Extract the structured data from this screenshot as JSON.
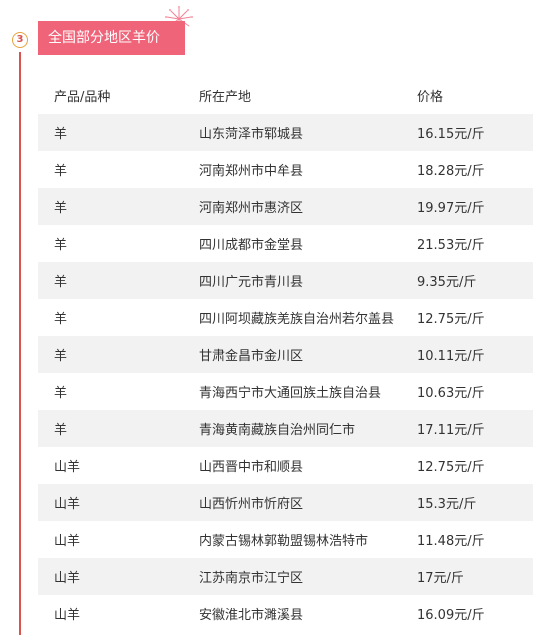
{
  "section": {
    "number": "3",
    "title": "全国部分地区羊价"
  },
  "table": {
    "headers": {
      "product": "产品/品种",
      "location": "所在产地",
      "price": "价格"
    },
    "rows": [
      {
        "product": "羊",
        "location": "山东菏泽市郓城县",
        "price": "16.15元/斤"
      },
      {
        "product": "羊",
        "location": "河南郑州市中牟县",
        "price": "18.28元/斤"
      },
      {
        "product": "羊",
        "location": "河南郑州市惠济区",
        "price": "19.97元/斤"
      },
      {
        "product": "羊",
        "location": "四川成都市金堂县",
        "price": "21.53元/斤"
      },
      {
        "product": "羊",
        "location": "四川广元市青川县",
        "price": "9.35元/斤"
      },
      {
        "product": "羊",
        "location": "四川阿坝藏族羌族自治州若尔盖县",
        "price": "12.75元/斤"
      },
      {
        "product": "羊",
        "location": "甘肃金昌市金川区",
        "price": "10.11元/斤"
      },
      {
        "product": "羊",
        "location": "青海西宁市大通回族土族自治县",
        "price": "10.63元/斤"
      },
      {
        "product": "羊",
        "location": "青海黄南藏族自治州同仁市",
        "price": "17.11元/斤"
      },
      {
        "product": "山羊",
        "location": "山西晋中市和顺县",
        "price": "12.75元/斤"
      },
      {
        "product": "山羊",
        "location": "山西忻州市忻府区",
        "price": "15.3元/斤"
      },
      {
        "product": "山羊",
        "location": "内蒙古锡林郭勒盟锡林浩特市",
        "price": "11.48元/斤"
      },
      {
        "product": "山羊",
        "location": "江苏南京市江宁区",
        "price": "17元/斤"
      },
      {
        "product": "山羊",
        "location": "安徽淮北市濉溪县",
        "price": "16.09元/斤"
      }
    ]
  },
  "colors": {
    "title_bg": "#f0647a",
    "timeline": "#d9534f",
    "row_stripe": "#f2f2f2"
  },
  "icons": {
    "decoration": "firework-icon"
  }
}
